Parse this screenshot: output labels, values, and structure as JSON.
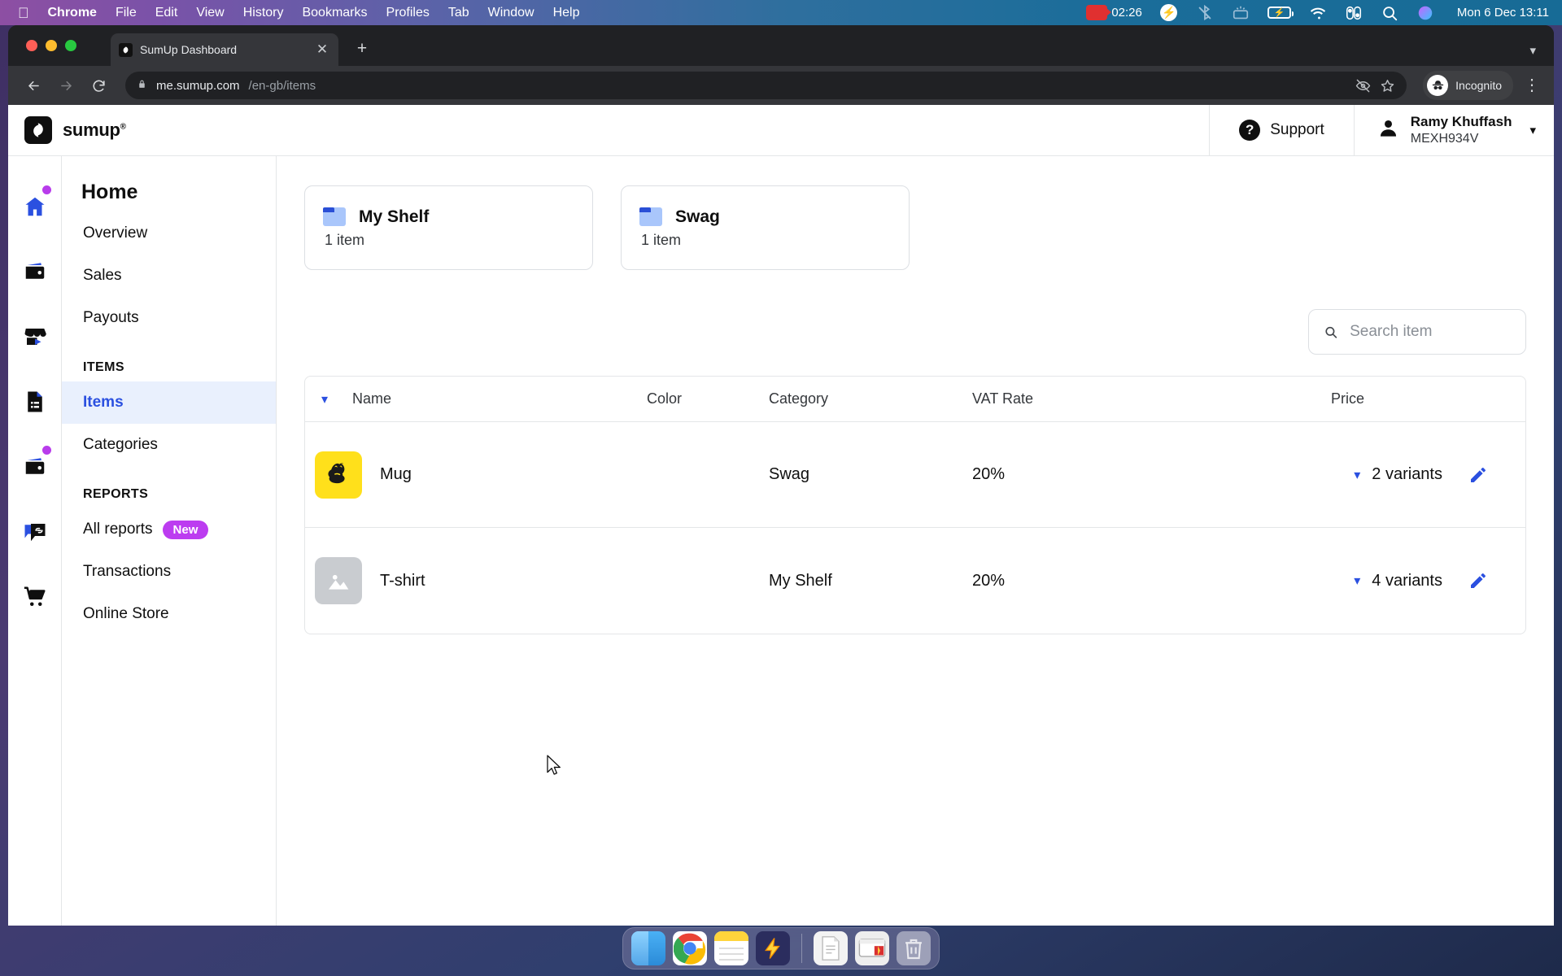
{
  "menubar": {
    "apple_icon": "apple-icon",
    "items": [
      {
        "label": "Chrome",
        "bold": true
      },
      {
        "label": "File",
        "bold": false
      },
      {
        "label": "Edit",
        "bold": false
      },
      {
        "label": "View",
        "bold": false
      },
      {
        "label": "History",
        "bold": false
      },
      {
        "label": "Bookmarks",
        "bold": false
      },
      {
        "label": "Profiles",
        "bold": false
      },
      {
        "label": "Tab",
        "bold": false
      },
      {
        "label": "Window",
        "bold": false
      },
      {
        "label": "Help",
        "bold": false
      }
    ],
    "recording_time": "02:26",
    "status_icons": [
      "screen-record-icon",
      "bolt-circle-icon",
      "bluetooth-off-icon",
      "keyboard-brightness-icon",
      "battery-charging-icon",
      "wifi-icon",
      "control-center-icon",
      "spotlight-search-icon",
      "siri-icon"
    ],
    "clock": "Mon 6 Dec  13:11"
  },
  "browser": {
    "tab": {
      "title": "SumUp Dashboard",
      "favicon": "sumup-favicon",
      "close_icon": "close-icon"
    },
    "new_tab_label": "+",
    "tab_list_chevron": "chevron-down-icon",
    "nav": {
      "back_icon": "back-arrow-icon",
      "forward_icon": "forward-arrow-icon",
      "reload_icon": "reload-icon"
    },
    "omnibox": {
      "lock_icon": "lock-icon",
      "url_domain": "me.sumup.com",
      "url_path": "/en-gb/items",
      "third_party_cookie_icon": "eye-slash-icon",
      "bookmark_icon": "star-icon"
    },
    "profile": {
      "label": "Incognito",
      "icon": "incognito-icon"
    },
    "menu_icon": "kebab-menu-icon"
  },
  "app": {
    "logo_text": "sumup",
    "logo_sup": "®",
    "logo_icon": "sumup-logo-icon",
    "support": {
      "label": "Support",
      "icon": "question-mark-icon"
    },
    "account": {
      "name": "Ramy Khuffash",
      "merchant_id": "MEXH934V",
      "avatar_icon": "person-icon",
      "chevron": "chevron-down-icon"
    }
  },
  "rail": {
    "items": [
      {
        "name": "home-icon",
        "badge": true
      },
      {
        "name": "wallet-icon",
        "badge": false
      },
      {
        "name": "store-icon",
        "badge": false
      },
      {
        "name": "invoice-icon",
        "badge": false
      },
      {
        "name": "items-wallet-icon",
        "badge": true
      },
      {
        "name": "link-chat-icon",
        "badge": false
      },
      {
        "name": "shopping-cart-icon",
        "badge": false
      }
    ]
  },
  "sidebar": {
    "title": "Home",
    "links": [
      {
        "label": "Overview",
        "active": false
      },
      {
        "label": "Sales",
        "active": false
      },
      {
        "label": "Payouts",
        "active": false
      }
    ],
    "groups": [
      {
        "title": "ITEMS",
        "links": [
          {
            "label": "Items",
            "active": true,
            "badge": null
          },
          {
            "label": "Categories",
            "active": false,
            "badge": null
          }
        ]
      },
      {
        "title": "REPORTS",
        "links": [
          {
            "label": "All reports",
            "active": false,
            "badge": "New"
          },
          {
            "label": "Transactions",
            "active": false,
            "badge": null
          },
          {
            "label": "Online Store",
            "active": false,
            "badge": null
          }
        ]
      }
    ]
  },
  "main": {
    "folders": [
      {
        "name": "My Shelf",
        "count": "1 item",
        "icon": "folder-icon"
      },
      {
        "name": "Swag",
        "count": "1 item",
        "icon": "folder-icon"
      }
    ],
    "search": {
      "placeholder": "Search item",
      "value": "",
      "icon": "search-icon"
    },
    "table": {
      "columns": [
        "Name",
        "Color",
        "Category",
        "VAT Rate",
        "Price"
      ],
      "sort_chevron": "chevron-down-icon",
      "rows": [
        {
          "name": "Mug",
          "thumbnail": "mailchimp-thumbnail",
          "color_hex": "#5FDD9D",
          "category": "Swag",
          "vat_rate": "20%",
          "price": "2 variants",
          "price_chevron": "chevron-down-icon",
          "edit_icon": "pencil-icon"
        },
        {
          "name": "T-shirt",
          "thumbnail": "image-placeholder-thumbnail",
          "color_hex": "#C8233F",
          "category": "My Shelf",
          "vat_rate": "20%",
          "price": "4 variants",
          "price_chevron": "chevron-down-icon",
          "edit_icon": "pencil-icon"
        }
      ]
    }
  },
  "dock": {
    "items": [
      {
        "name": "finder-icon",
        "running": true
      },
      {
        "name": "chrome-icon",
        "running": true
      },
      {
        "name": "notes-icon",
        "running": true
      },
      {
        "name": "bolt-app-icon",
        "running": true
      },
      {
        "name": "document-icon",
        "running": false
      },
      {
        "name": "window-preview-icon",
        "running": false
      },
      {
        "name": "trash-icon",
        "running": false
      }
    ]
  },
  "colors": {
    "accent_blue": "#2b50e0",
    "badge_purple": "#bc3cf0",
    "active_nav_bg": "#e9f0fd"
  }
}
